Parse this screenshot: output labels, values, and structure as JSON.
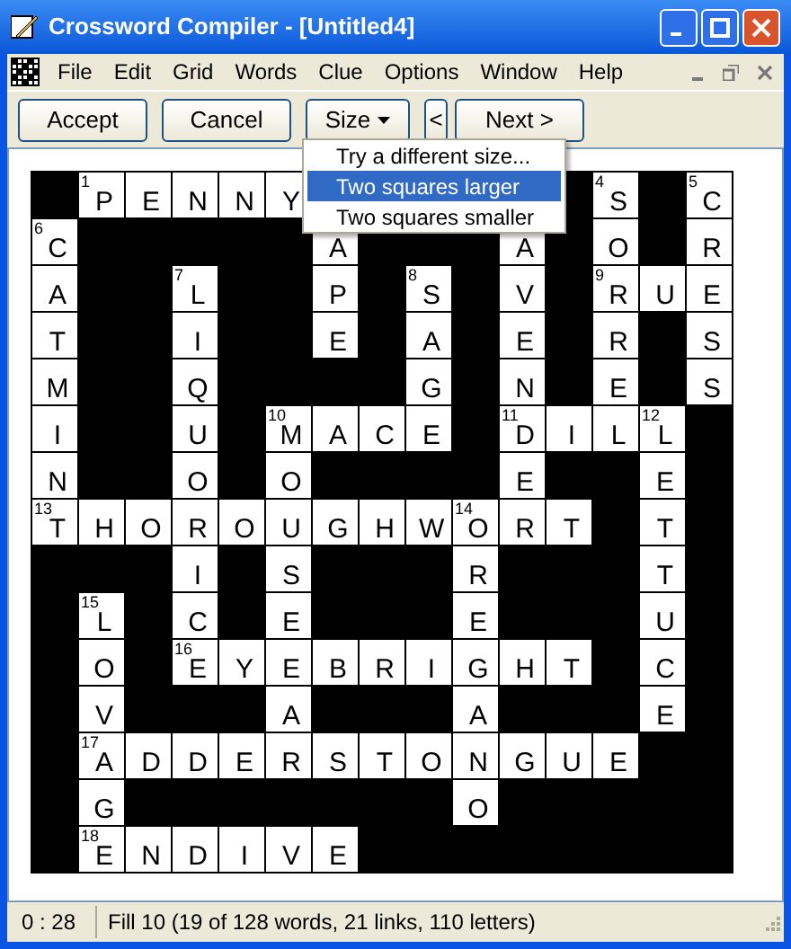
{
  "window": {
    "title": "Crossword Compiler - [Untitled4]"
  },
  "menu": [
    "File",
    "Edit",
    "Grid",
    "Words",
    "Clue",
    "Options",
    "Window",
    "Help"
  ],
  "toolbar": [
    {
      "label": "Accept",
      "kind": "button"
    },
    {
      "label": "Cancel",
      "kind": "button"
    },
    {
      "label": "Size",
      "kind": "dropdown"
    },
    {
      "label": "<",
      "kind": "small"
    },
    {
      "label": "Next >",
      "kind": "button"
    }
  ],
  "dropdown_menu": [
    {
      "label": "Try a different size...",
      "selected": false
    },
    {
      "label": "Two squares larger",
      "selected": true
    },
    {
      "label": "Two squares smaller",
      "selected": false
    }
  ],
  "grid": [
    [
      {
        "kind": "black"
      },
      {
        "kind": "letter",
        "letter": "P",
        "number": "1"
      },
      {
        "kind": "letter",
        "letter": "E"
      },
      {
        "kind": "letter",
        "letter": "N"
      },
      {
        "kind": "letter",
        "letter": "N"
      },
      {
        "kind": "letter",
        "letter": "Y"
      },
      {
        "kind": "blank"
      },
      {
        "kind": "blank"
      },
      {
        "kind": "blank"
      },
      {
        "kind": "blank"
      },
      {
        "kind": "blank"
      },
      {
        "kind": "black"
      },
      {
        "kind": "letter",
        "letter": "S",
        "number": "4"
      },
      {
        "kind": "black"
      },
      {
        "kind": "letter",
        "letter": "C",
        "number": "5"
      }
    ],
    [
      {
        "kind": "letter",
        "letter": "C",
        "number": "6"
      },
      {
        "kind": "black"
      },
      {
        "kind": "black"
      },
      {
        "kind": "black"
      },
      {
        "kind": "black"
      },
      {
        "kind": "black"
      },
      {
        "kind": "letter",
        "letter": "A"
      },
      {
        "kind": "black"
      },
      {
        "kind": "black"
      },
      {
        "kind": "black"
      },
      {
        "kind": "letter",
        "letter": "A"
      },
      {
        "kind": "black"
      },
      {
        "kind": "letter",
        "letter": "O"
      },
      {
        "kind": "black"
      },
      {
        "kind": "letter",
        "letter": "R"
      }
    ],
    [
      {
        "kind": "letter",
        "letter": "A"
      },
      {
        "kind": "black"
      },
      {
        "kind": "black"
      },
      {
        "kind": "letter",
        "letter": "L",
        "number": "7"
      },
      {
        "kind": "black"
      },
      {
        "kind": "black"
      },
      {
        "kind": "letter",
        "letter": "P"
      },
      {
        "kind": "black"
      },
      {
        "kind": "letter",
        "letter": "S",
        "number": "8"
      },
      {
        "kind": "black"
      },
      {
        "kind": "letter",
        "letter": "V"
      },
      {
        "kind": "black"
      },
      {
        "kind": "letter",
        "letter": "R",
        "number": "9"
      },
      {
        "kind": "letter",
        "letter": "U"
      },
      {
        "kind": "letter",
        "letter": "E"
      }
    ],
    [
      {
        "kind": "letter",
        "letter": "T"
      },
      {
        "kind": "black"
      },
      {
        "kind": "black"
      },
      {
        "kind": "letter",
        "letter": "I"
      },
      {
        "kind": "black"
      },
      {
        "kind": "black"
      },
      {
        "kind": "letter",
        "letter": "E"
      },
      {
        "kind": "black"
      },
      {
        "kind": "letter",
        "letter": "A"
      },
      {
        "kind": "black"
      },
      {
        "kind": "letter",
        "letter": "E"
      },
      {
        "kind": "black"
      },
      {
        "kind": "letter",
        "letter": "R"
      },
      {
        "kind": "black"
      },
      {
        "kind": "letter",
        "letter": "S"
      }
    ],
    [
      {
        "kind": "letter",
        "letter": "M"
      },
      {
        "kind": "black"
      },
      {
        "kind": "black"
      },
      {
        "kind": "letter",
        "letter": "Q"
      },
      {
        "kind": "black"
      },
      {
        "kind": "black"
      },
      {
        "kind": "black"
      },
      {
        "kind": "black"
      },
      {
        "kind": "letter",
        "letter": "G"
      },
      {
        "kind": "black"
      },
      {
        "kind": "letter",
        "letter": "N"
      },
      {
        "kind": "black"
      },
      {
        "kind": "letter",
        "letter": "E"
      },
      {
        "kind": "black"
      },
      {
        "kind": "letter",
        "letter": "S"
      }
    ],
    [
      {
        "kind": "letter",
        "letter": "I"
      },
      {
        "kind": "black"
      },
      {
        "kind": "black"
      },
      {
        "kind": "letter",
        "letter": "U"
      },
      {
        "kind": "black"
      },
      {
        "kind": "letter",
        "letter": "M",
        "number": "10"
      },
      {
        "kind": "letter",
        "letter": "A"
      },
      {
        "kind": "letter",
        "letter": "C"
      },
      {
        "kind": "letter",
        "letter": "E"
      },
      {
        "kind": "black"
      },
      {
        "kind": "letter",
        "letter": "D",
        "number": "11"
      },
      {
        "kind": "letter",
        "letter": "I"
      },
      {
        "kind": "letter",
        "letter": "L"
      },
      {
        "kind": "letter",
        "letter": "L",
        "number": "12"
      },
      {
        "kind": "black"
      }
    ],
    [
      {
        "kind": "letter",
        "letter": "N"
      },
      {
        "kind": "black"
      },
      {
        "kind": "black"
      },
      {
        "kind": "letter",
        "letter": "O"
      },
      {
        "kind": "black"
      },
      {
        "kind": "letter",
        "letter": "O"
      },
      {
        "kind": "black"
      },
      {
        "kind": "black"
      },
      {
        "kind": "black"
      },
      {
        "kind": "black"
      },
      {
        "kind": "letter",
        "letter": "E"
      },
      {
        "kind": "black"
      },
      {
        "kind": "black"
      },
      {
        "kind": "letter",
        "letter": "E"
      },
      {
        "kind": "black"
      }
    ],
    [
      {
        "kind": "letter",
        "letter": "T",
        "number": "13"
      },
      {
        "kind": "letter",
        "letter": "H"
      },
      {
        "kind": "letter",
        "letter": "O"
      },
      {
        "kind": "letter",
        "letter": "R"
      },
      {
        "kind": "letter",
        "letter": "O"
      },
      {
        "kind": "letter",
        "letter": "U"
      },
      {
        "kind": "letter",
        "letter": "G"
      },
      {
        "kind": "letter",
        "letter": "H"
      },
      {
        "kind": "letter",
        "letter": "W"
      },
      {
        "kind": "letter",
        "letter": "O",
        "number": "14"
      },
      {
        "kind": "letter",
        "letter": "R"
      },
      {
        "kind": "letter",
        "letter": "T"
      },
      {
        "kind": "black"
      },
      {
        "kind": "letter",
        "letter": "T"
      },
      {
        "kind": "black"
      }
    ],
    [
      {
        "kind": "black"
      },
      {
        "kind": "black"
      },
      {
        "kind": "black"
      },
      {
        "kind": "letter",
        "letter": "I"
      },
      {
        "kind": "black"
      },
      {
        "kind": "letter",
        "letter": "S"
      },
      {
        "kind": "black"
      },
      {
        "kind": "black"
      },
      {
        "kind": "black"
      },
      {
        "kind": "letter",
        "letter": "R"
      },
      {
        "kind": "black"
      },
      {
        "kind": "black"
      },
      {
        "kind": "black"
      },
      {
        "kind": "letter",
        "letter": "T"
      },
      {
        "kind": "black"
      }
    ],
    [
      {
        "kind": "black"
      },
      {
        "kind": "letter",
        "letter": "L",
        "number": "15"
      },
      {
        "kind": "black"
      },
      {
        "kind": "letter",
        "letter": "C"
      },
      {
        "kind": "black"
      },
      {
        "kind": "letter",
        "letter": "E"
      },
      {
        "kind": "black"
      },
      {
        "kind": "black"
      },
      {
        "kind": "black"
      },
      {
        "kind": "letter",
        "letter": "E"
      },
      {
        "kind": "black"
      },
      {
        "kind": "black"
      },
      {
        "kind": "black"
      },
      {
        "kind": "letter",
        "letter": "U"
      },
      {
        "kind": "black"
      }
    ],
    [
      {
        "kind": "black"
      },
      {
        "kind": "letter",
        "letter": "O"
      },
      {
        "kind": "black"
      },
      {
        "kind": "letter",
        "letter": "E",
        "number": "16"
      },
      {
        "kind": "letter",
        "letter": "Y"
      },
      {
        "kind": "letter",
        "letter": "E"
      },
      {
        "kind": "letter",
        "letter": "B"
      },
      {
        "kind": "letter",
        "letter": "R"
      },
      {
        "kind": "letter",
        "letter": "I"
      },
      {
        "kind": "letter",
        "letter": "G"
      },
      {
        "kind": "letter",
        "letter": "H"
      },
      {
        "kind": "letter",
        "letter": "T"
      },
      {
        "kind": "black"
      },
      {
        "kind": "letter",
        "letter": "C"
      },
      {
        "kind": "black"
      }
    ],
    [
      {
        "kind": "black"
      },
      {
        "kind": "letter",
        "letter": "V"
      },
      {
        "kind": "black"
      },
      {
        "kind": "black"
      },
      {
        "kind": "black"
      },
      {
        "kind": "letter",
        "letter": "A"
      },
      {
        "kind": "black"
      },
      {
        "kind": "black"
      },
      {
        "kind": "black"
      },
      {
        "kind": "letter",
        "letter": "A"
      },
      {
        "kind": "black"
      },
      {
        "kind": "black"
      },
      {
        "kind": "black"
      },
      {
        "kind": "letter",
        "letter": "E"
      },
      {
        "kind": "black"
      }
    ],
    [
      {
        "kind": "black"
      },
      {
        "kind": "letter",
        "letter": "A",
        "number": "17"
      },
      {
        "kind": "letter",
        "letter": "D"
      },
      {
        "kind": "letter",
        "letter": "D"
      },
      {
        "kind": "letter",
        "letter": "E"
      },
      {
        "kind": "letter",
        "letter": "R"
      },
      {
        "kind": "letter",
        "letter": "S"
      },
      {
        "kind": "letter",
        "letter": "T"
      },
      {
        "kind": "letter",
        "letter": "O"
      },
      {
        "kind": "letter",
        "letter": "N"
      },
      {
        "kind": "letter",
        "letter": "G"
      },
      {
        "kind": "letter",
        "letter": "U"
      },
      {
        "kind": "letter",
        "letter": "E"
      },
      {
        "kind": "black"
      },
      {
        "kind": "black"
      }
    ],
    [
      {
        "kind": "black"
      },
      {
        "kind": "letter",
        "letter": "G"
      },
      {
        "kind": "black"
      },
      {
        "kind": "black"
      },
      {
        "kind": "black"
      },
      {
        "kind": "black"
      },
      {
        "kind": "black"
      },
      {
        "kind": "black"
      },
      {
        "kind": "black"
      },
      {
        "kind": "letter",
        "letter": "O"
      },
      {
        "kind": "black"
      },
      {
        "kind": "black"
      },
      {
        "kind": "black"
      },
      {
        "kind": "black"
      },
      {
        "kind": "black"
      }
    ],
    [
      {
        "kind": "black"
      },
      {
        "kind": "letter",
        "letter": "E",
        "number": "18"
      },
      {
        "kind": "letter",
        "letter": "N"
      },
      {
        "kind": "letter",
        "letter": "D"
      },
      {
        "kind": "letter",
        "letter": "I"
      },
      {
        "kind": "letter",
        "letter": "V"
      },
      {
        "kind": "letter",
        "letter": "E"
      },
      {
        "kind": "black"
      },
      {
        "kind": "black"
      },
      {
        "kind": "black"
      },
      {
        "kind": "black"
      },
      {
        "kind": "black"
      },
      {
        "kind": "black"
      },
      {
        "kind": "black"
      },
      {
        "kind": "black"
      }
    ]
  ],
  "status_bar": {
    "time": "0 : 28",
    "message": "Fill 10 (19 of 128 words, 21 links, 110 letters)"
  }
}
